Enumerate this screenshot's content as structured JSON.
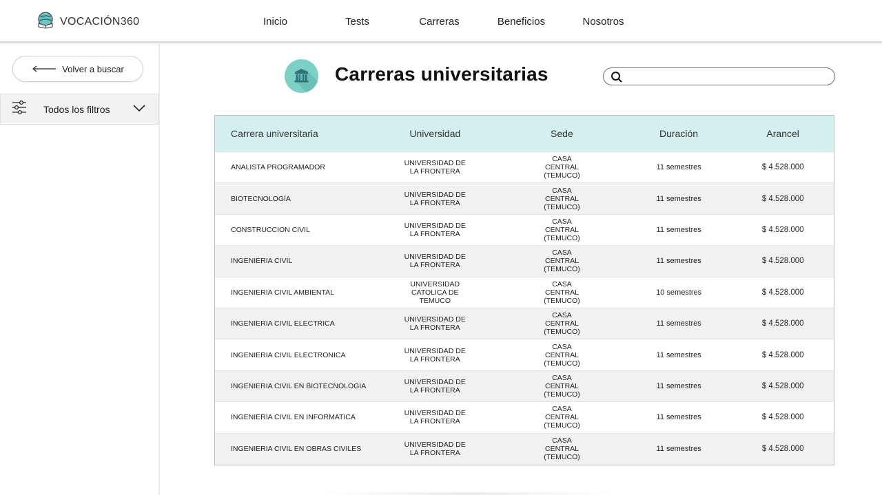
{
  "app": {
    "name": "VOCACIÓN360"
  },
  "nav": [
    "Inicio",
    "Tests",
    "Carreras",
    "Beneficios",
    "Nosotros"
  ],
  "sidebar": {
    "back_label": "Volver a buscar",
    "filters_label": "Todos los filtros"
  },
  "main": {
    "title": "Carreras universitarias",
    "search_placeholder": ""
  },
  "table": {
    "headers": [
      "Carrera universitaria",
      "Universidad",
      "Sede",
      "Duración",
      "Arancel"
    ],
    "rows": [
      [
        "ANALISTA PROGRAMADOR",
        "UNIVERSIDAD DE LA FRONTERA",
        "CASA CENTRAL (TEMUCO)",
        "11 semestres",
        "$ 4.528.000"
      ],
      [
        "BIOTECNOLOGÍA",
        "UNIVERSIDAD DE LA FRONTERA",
        "CASA CENTRAL (TEMUCO)",
        "11 semestres",
        "$ 4.528.000"
      ],
      [
        "CONSTRUCCION CIVIL",
        "UNIVERSIDAD DE LA FRONTERA",
        "CASA CENTRAL (TEMUCO)",
        "11 semestres",
        "$ 4.528.000"
      ],
      [
        "INGENIERIA CIVIL",
        "UNIVERSIDAD DE LA FRONTERA",
        "CASA CENTRAL (TEMUCO)",
        "11 semestres",
        "$ 4.528.000"
      ],
      [
        "INGENIERIA CIVIL AMBIENTAL",
        "UNIVERSIDAD CATOLICA DE TEMUCO",
        "CASA CENTRAL (TEMUCO)",
        "10 semestres",
        "$ 4.528.000"
      ],
      [
        "INGENIERIA CIVIL ELECTRICA",
        "UNIVERSIDAD DE LA FRONTERA",
        "CASA CENTRAL (TEMUCO)",
        "11 semestres",
        "$ 4.528.000"
      ],
      [
        "INGENIERIA CIVIL ELECTRONICA",
        "UNIVERSIDAD DE LA FRONTERA",
        "CASA CENTRAL (TEMUCO)",
        "11 semestres",
        "$ 4.528.000"
      ],
      [
        "INGENIERIA CIVIL EN BIOTECNOLOGIA",
        "UNIVERSIDAD DE LA FRONTERA",
        "CASA CENTRAL (TEMUCO)",
        "11 semestres",
        "$ 4.528.000"
      ],
      [
        "INGENIERIA CIVIL EN INFORMATICA",
        "UNIVERSIDAD DE LA FRONTERA",
        "CASA CENTRAL (TEMUCO)",
        "11 semestres",
        "$ 4.528.000"
      ],
      [
        "INGENIERIA CIVIL EN OBRAS CIVILES",
        "UNIVERSIDAD DE LA FRONTERA",
        "CASA CENTRAL (TEMUCO)",
        "11 semestres",
        "$ 4.528.000"
      ]
    ]
  },
  "colors": {
    "header_row": "#d3f0ee",
    "accent": "#7cd0c6",
    "alt_row": "#f1f1f1"
  },
  "icons": [
    "globe-book-logo-icon",
    "arrow-left-icon",
    "sliders-icon",
    "chevron-down-icon",
    "university-icon",
    "search-icon"
  ]
}
